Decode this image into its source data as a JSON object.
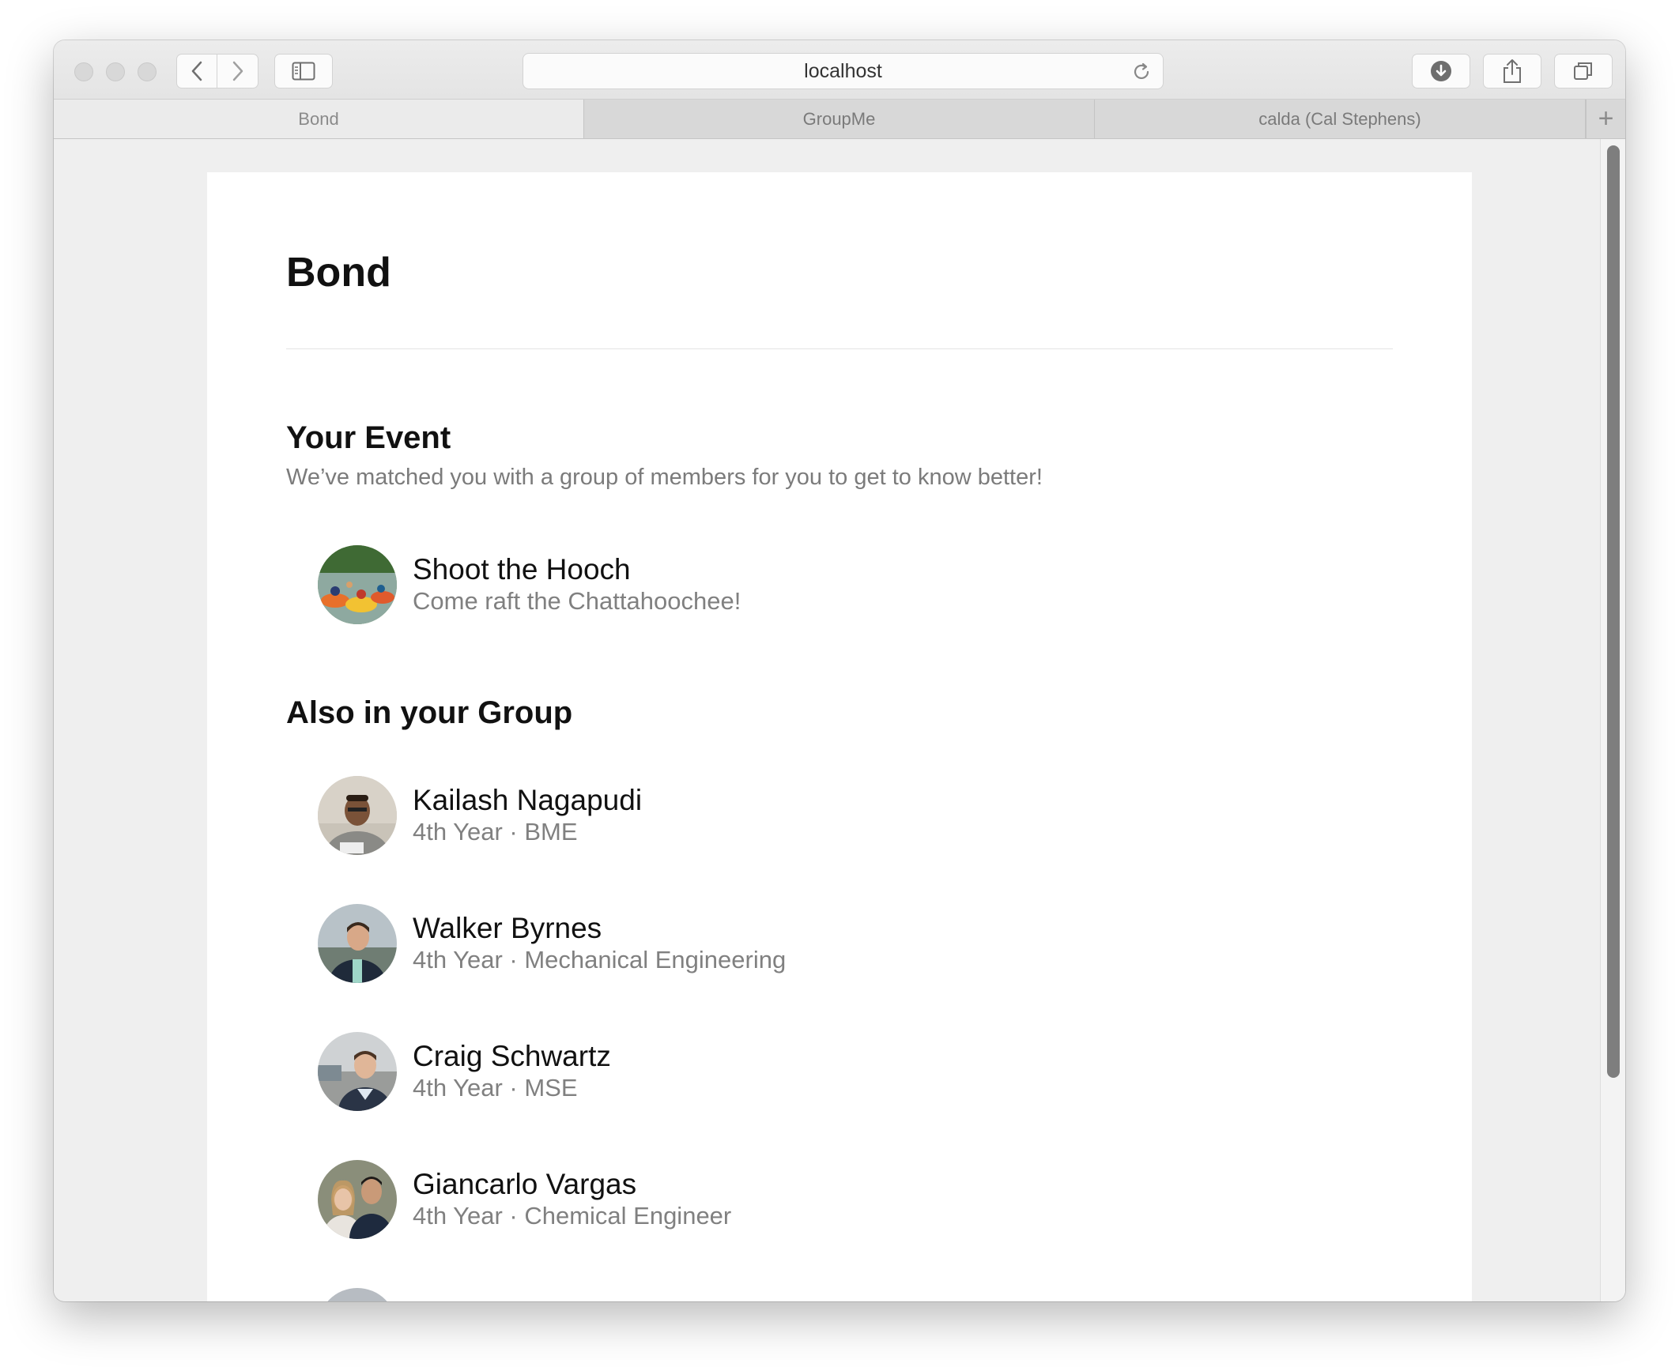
{
  "browser": {
    "url": "localhost",
    "tabs": [
      {
        "label": "Bond",
        "active": true
      },
      {
        "label": "GroupMe",
        "active": false
      },
      {
        "label": "calda (Cal Stephens)",
        "active": false
      }
    ],
    "new_tab_glyph": "+"
  },
  "page": {
    "title": "Bond",
    "event_section": {
      "title": "Your Event",
      "subtitle": "We’ve matched you with a group of members for you to get to know better!",
      "event": {
        "name": "Shoot the Hooch",
        "description": "Come raft the Chattahoochee!"
      }
    },
    "group_section": {
      "title": "Also in your Group",
      "members": [
        {
          "name": "Kailash Nagapudi",
          "detail": "4th Year · BME"
        },
        {
          "name": "Walker Byrnes",
          "detail": "4th Year · Mechanical Engineering"
        },
        {
          "name": "Craig Schwartz",
          "detail": "4th Year · MSE"
        },
        {
          "name": "Giancarlo Vargas",
          "detail": "4th Year · Chemical Engineer"
        }
      ]
    }
  },
  "colors": {
    "text_primary": "#111111",
    "text_secondary": "#7b7b7b",
    "page_background": "#efefef",
    "card_background": "#ffffff"
  }
}
